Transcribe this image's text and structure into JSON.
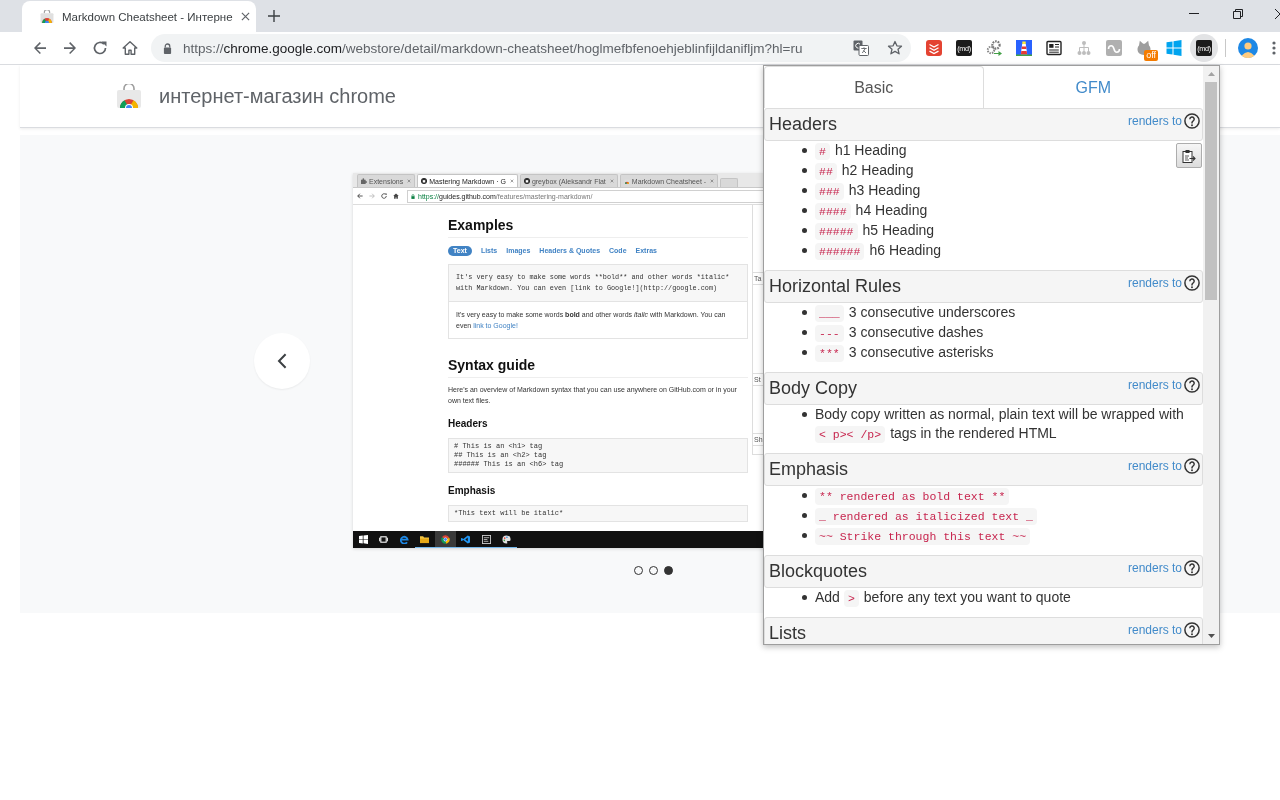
{
  "browser": {
    "tabs": [
      {
        "title": "Markdown Cheatsheet - Интерне",
        "selected": true
      }
    ],
    "address": {
      "scheme": "https://",
      "host": "chrome.google.com",
      "path": "/webstore/detail/markdown-cheatsheet/hoglmefbfenoehjeblinfijldanifljm?hl=ru"
    },
    "extensions": [
      {
        "kind": "stack",
        "active": false
      },
      {
        "kind": "md",
        "label": "(md)",
        "active": false
      },
      {
        "kind": "gears",
        "active": false
      },
      {
        "kind": "lighthouse",
        "active": false
      },
      {
        "kind": "newspaper",
        "active": false
      },
      {
        "kind": "tree",
        "active": false
      },
      {
        "kind": "loop",
        "active": false
      },
      {
        "kind": "cat",
        "badge": "off",
        "active": false
      },
      {
        "kind": "panes",
        "active": false
      },
      {
        "kind": "md",
        "label": "(md)",
        "active": true
      }
    ]
  },
  "store": {
    "title": "интернет-магазин chrome"
  },
  "carousel": {
    "slide": {
      "tabs": [
        {
          "kind": "puzzle",
          "title": "Extensions",
          "selected": false
        },
        {
          "kind": "octocat",
          "title": "Mastering Markdown · G",
          "selected": true
        },
        {
          "kind": "octocat",
          "title": "greybox (Aleksandr Flat",
          "selected": false
        },
        {
          "kind": "bag",
          "title": "Markdown Cheatsheet -",
          "selected": false
        }
      ],
      "address": {
        "scheme": "https://",
        "host": "guides.github.com",
        "path": "/features/mastering-markdown/",
        "forward_disabled": true
      },
      "heading": "Examples",
      "nav": [
        {
          "label": "Text",
          "selected": true
        },
        {
          "label": "Lists",
          "selected": false
        },
        {
          "label": "Images",
          "selected": false
        },
        {
          "label": "Headers & Quotes",
          "selected": false
        },
        {
          "label": "Code",
          "selected": false
        },
        {
          "label": "Extras",
          "selected": false
        }
      ],
      "source": [
        "It's very easy to make some words **bold** and other words *italic*",
        "with Markdown. You can even [link to Google!](http://google.com)"
      ],
      "rendered": {
        "text": "It's very easy to make some words **bold** and other words *italic* with Markdown. You can even",
        "link": "link to Google!"
      },
      "syntax_heading": "Syntax guide",
      "intro": "Here's an overview of Markdown syntax that you can use anywhere on GitHub.com or in your own text files.",
      "sections": [
        {
          "heading": "Headers",
          "code": [
            "# This is an <h1> tag",
            "## This is an <h2> tag",
            "###### This is an <h6> tag"
          ]
        },
        {
          "heading": "Emphasis",
          "code": [
            "*This text will be italic*"
          ]
        }
      ],
      "side_tabs": [
        "Ta",
        "St",
        "Sh"
      ],
      "taskbar": [
        {
          "kind": "start",
          "running": false,
          "active": false
        },
        {
          "kind": "taskview",
          "running": false,
          "active": false
        },
        {
          "kind": "edge",
          "running": false,
          "active": false
        },
        {
          "kind": "folder",
          "running": true,
          "active": false
        },
        {
          "kind": "chrome",
          "running": true,
          "active": true
        },
        {
          "kind": "code",
          "running": true,
          "active": false
        },
        {
          "kind": "terminal",
          "running": true,
          "active": false
        },
        {
          "kind": "paint",
          "running": true,
          "active": false
        }
      ]
    },
    "dots": [
      {
        "selected": false
      },
      {
        "selected": false
      },
      {
        "selected": true
      }
    ]
  },
  "popup": {
    "tabs": [
      {
        "label": "Basic",
        "selected": true
      },
      {
        "label": "GFM",
        "selected": false
      }
    ],
    "sections": [
      {
        "title": "Headers",
        "link": "renders to",
        "copy_button": true,
        "items": [
          {
            "code": "#",
            "text": "h1 Heading"
          },
          {
            "code": "##",
            "text": "h2 Heading"
          },
          {
            "code": "###",
            "text": "h3 Heading"
          },
          {
            "code": "####",
            "text": "h4 Heading"
          },
          {
            "code": "#####",
            "text": "h5 Heading"
          },
          {
            "code": "######",
            "text": "h6 Heading"
          }
        ]
      },
      {
        "title": "Horizontal Rules",
        "link": "renders to",
        "copy_button": false,
        "items": [
          {
            "code": "___",
            "text": "3 consecutive underscores"
          },
          {
            "code": "---",
            "text": "3 consecutive dashes"
          },
          {
            "code": "***",
            "text": "3 consecutive asterisks"
          }
        ]
      },
      {
        "title": "Body Copy",
        "link": "renders to",
        "copy_button": false,
        "items": [
          {
            "before": "Body copy written as normal, plain text will be wrapped with",
            "code": "< p>< /p>",
            "text": "tags in the rendered HTML"
          }
        ]
      },
      {
        "title": "Emphasis",
        "link": "renders to",
        "copy_button": false,
        "items": [
          {
            "code": "** rendered as bold text **"
          },
          {
            "code": "_ rendered as italicized text _"
          },
          {
            "code": "~~ Strike through this text ~~"
          }
        ]
      },
      {
        "title": "Blockquotes",
        "link": "renders to",
        "copy_button": false,
        "items": [
          {
            "before": "Add",
            "code": ">",
            "text": "before any text you want to quote"
          }
        ]
      },
      {
        "title": "Lists",
        "link": "renders to",
        "copy_button": false
      }
    ]
  }
}
